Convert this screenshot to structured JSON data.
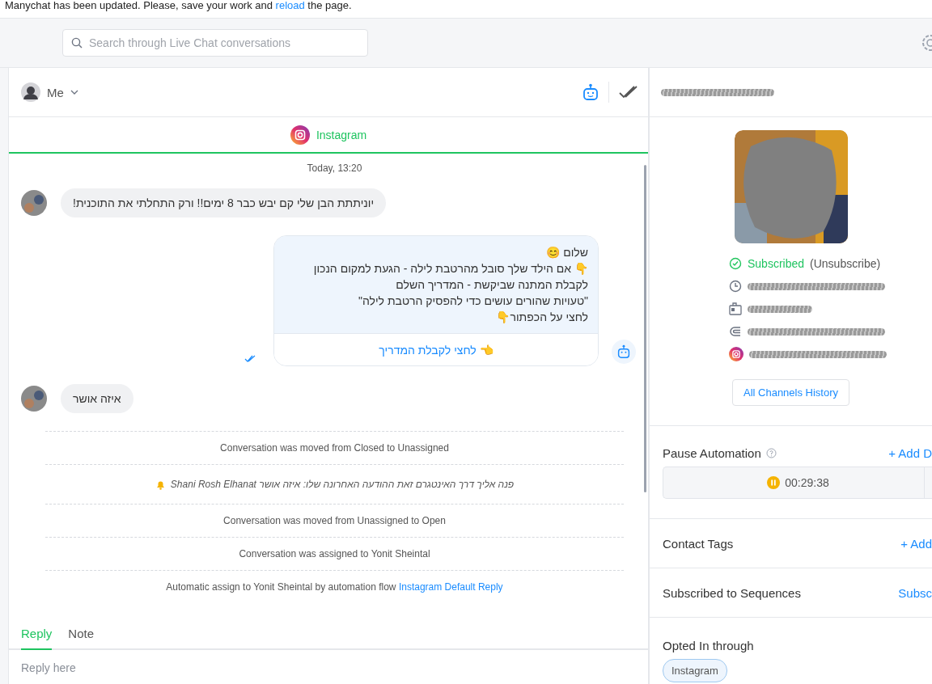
{
  "notice": {
    "before": "Manychat has been updated. Please, save your work and",
    "link": "reload",
    "after": "the page."
  },
  "search": {
    "placeholder": "Search through Live Chat conversations"
  },
  "chat": {
    "assignee": "Me",
    "channel": {
      "label": "Instagram",
      "selected": true
    },
    "date": "Today, 13:20",
    "messages": [
      {
        "kind": "incoming",
        "text": "יוניתתת הבן שלי קם יבש כבר 8 ימים!! ורק התחלתי את התוכנית!"
      },
      {
        "kind": "bot",
        "lines": [
          "שלום 😊",
          "👇 אם הילד שלך סובל מהרטבת לילה - הגעת למקום הנכון",
          "לקבלת המתנה שביקשת - המדריך השלם",
          "\"טעויות שהורים עושים כדי להפסיק הרטבת לילה\"",
          "לחצי על הכפתור👇"
        ],
        "button": "👈 לחצי לקבלת המדריך"
      },
      {
        "kind": "incoming",
        "text": "איזה אושר"
      },
      {
        "kind": "event",
        "text": "Conversation was moved from Closed to Unassigned"
      },
      {
        "kind": "notification",
        "text": "פנה אליך דרך האינטגרם זאת ההודעה האחרונה שלו: איזה אושר",
        "name": "Shani Rosh Elhanat"
      },
      {
        "kind": "event",
        "text": "Conversation was moved from Unassigned to Open"
      },
      {
        "kind": "event",
        "text": "Conversation was assigned to Yonit Sheintal"
      },
      {
        "kind": "event",
        "text": "Automatic assign to Yonit Sheintal by automation flow",
        "link": "Instagram Default Reply"
      }
    ],
    "tabs": [
      {
        "label": "Reply",
        "selected": true
      },
      {
        "label": "Note",
        "selected": false
      }
    ],
    "reply": {
      "placeholder": "Reply here"
    }
  },
  "contact": {
    "info_rows": [
      {
        "kind": "status",
        "status": "Subscribed",
        "action": "(Unsubscribe)"
      },
      {
        "kind": "time"
      },
      {
        "kind": "id"
      },
      {
        "kind": "opt-in"
      },
      {
        "kind": "instagram"
      }
    ],
    "history_button": "All Channels History",
    "pause": {
      "title": "Pause Automation",
      "action": "+ Add D",
      "timer": "00:29:38"
    },
    "sections": [
      {
        "title": "Contact Tags",
        "action": "+ Add"
      },
      {
        "title": "Subscribed to Sequences",
        "action": "Subsc"
      }
    ],
    "opted_in": {
      "title": "Opted In through",
      "chip": "Instagram"
    }
  }
}
